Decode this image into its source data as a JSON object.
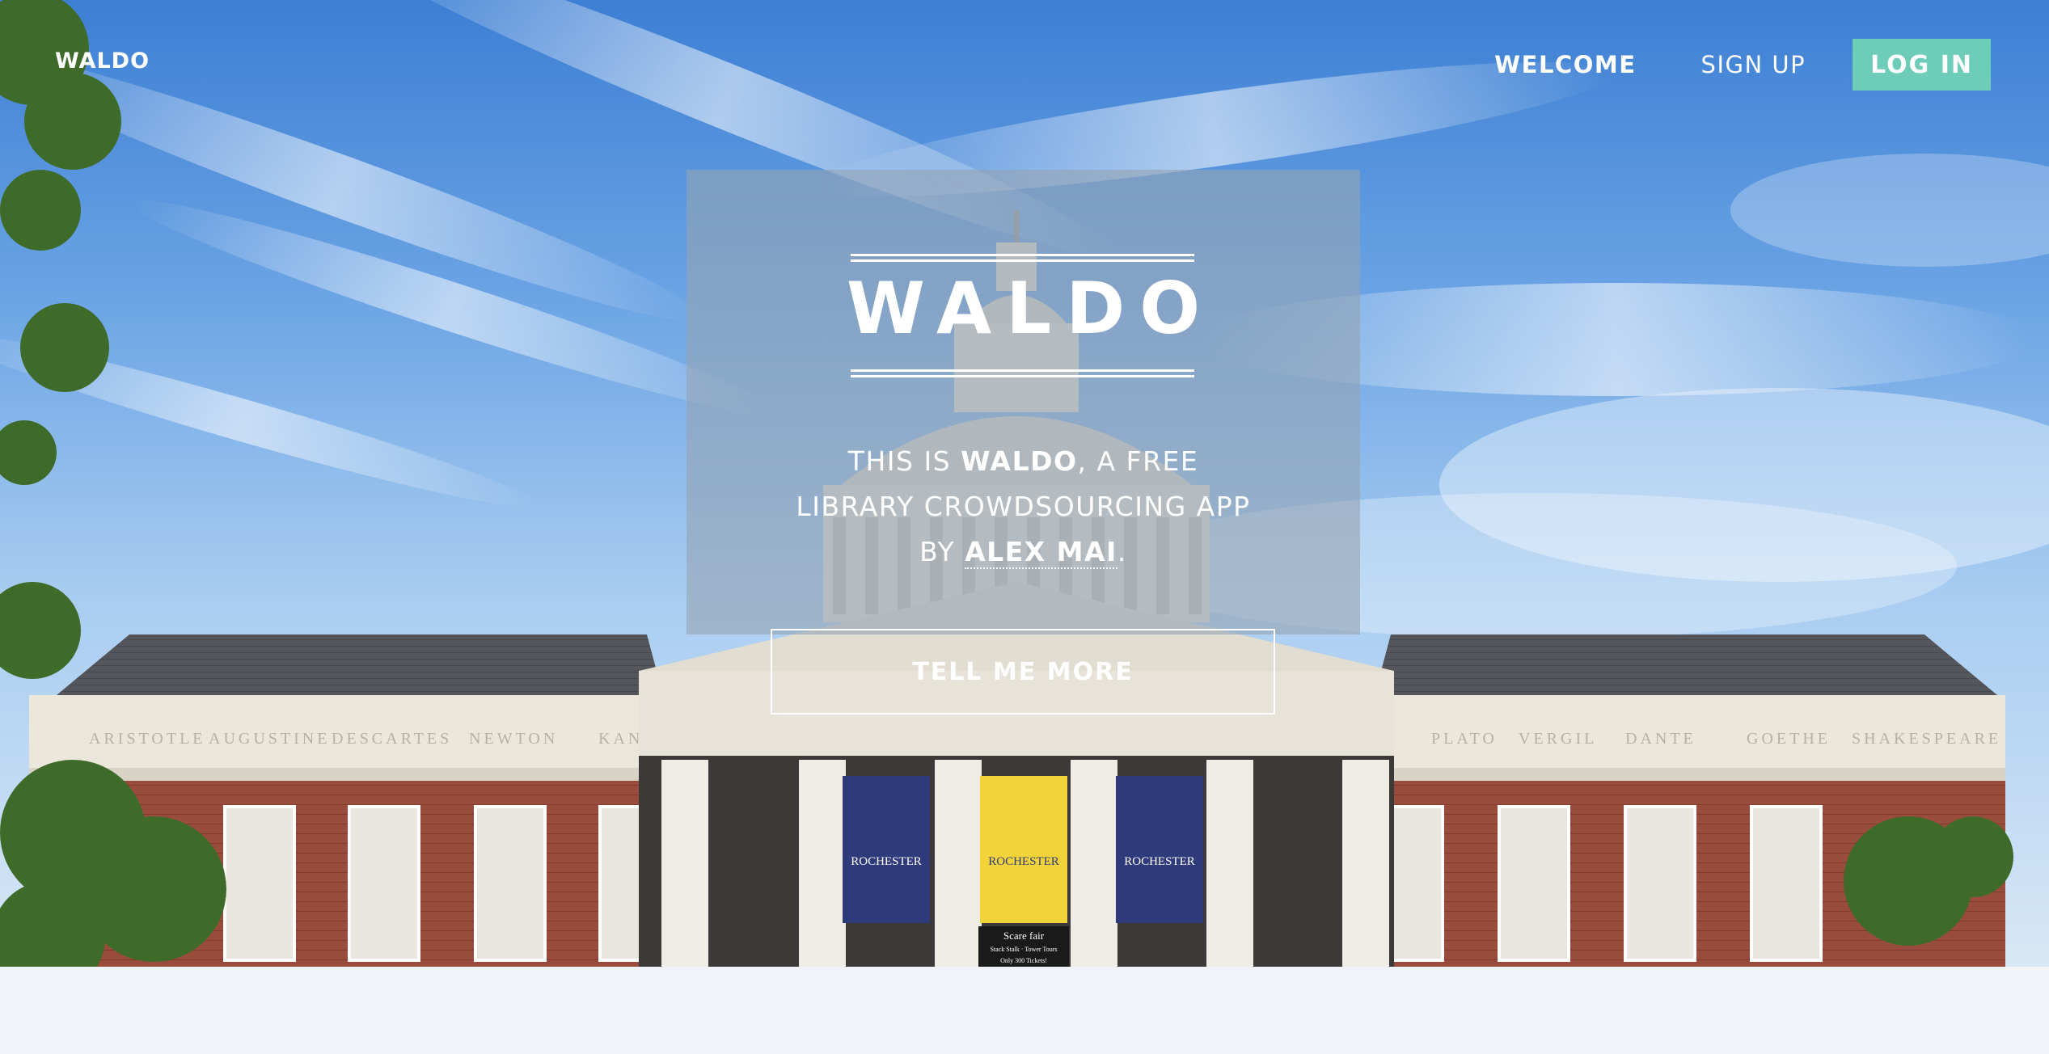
{
  "navbar": {
    "brand": "WALDO",
    "links": [
      {
        "label": "WELCOME",
        "active": true
      },
      {
        "label": "SIGN UP",
        "active": false
      }
    ],
    "login_label": "LOG IN"
  },
  "hero": {
    "title": "WALDO",
    "tagline": {
      "line1_prefix": "THIS IS ",
      "app_name": "WALDO",
      "line1_suffix": ", A FREE",
      "line2": "LIBRARY CROWDSOURCING APP",
      "line3_prefix": "BY ",
      "author": "ALEX MAI",
      "line3_suffix": "."
    },
    "cta_label": "TELL ME MORE"
  },
  "building": {
    "frieze_names": [
      "ARISTOTLE",
      "AUGUSTINE",
      "DESCARTES",
      "NEWTON",
      "KANT",
      "PLATO",
      "VERGIL",
      "DANTE",
      "GOETHE",
      "SHAKESPEARE"
    ],
    "banner_text": [
      "ROCHESTER",
      "ROCHESTER",
      "ROCHESTER"
    ],
    "sign_lines": [
      "Scare fair",
      "Stack Stalk · Tower Tours",
      "Only 300 Tickets!"
    ]
  },
  "colors": {
    "accent": "#6ecdb8",
    "banner_blue": "#2f3a7a",
    "banner_yellow": "#f2d43a",
    "brick": "#9a4c3c"
  }
}
